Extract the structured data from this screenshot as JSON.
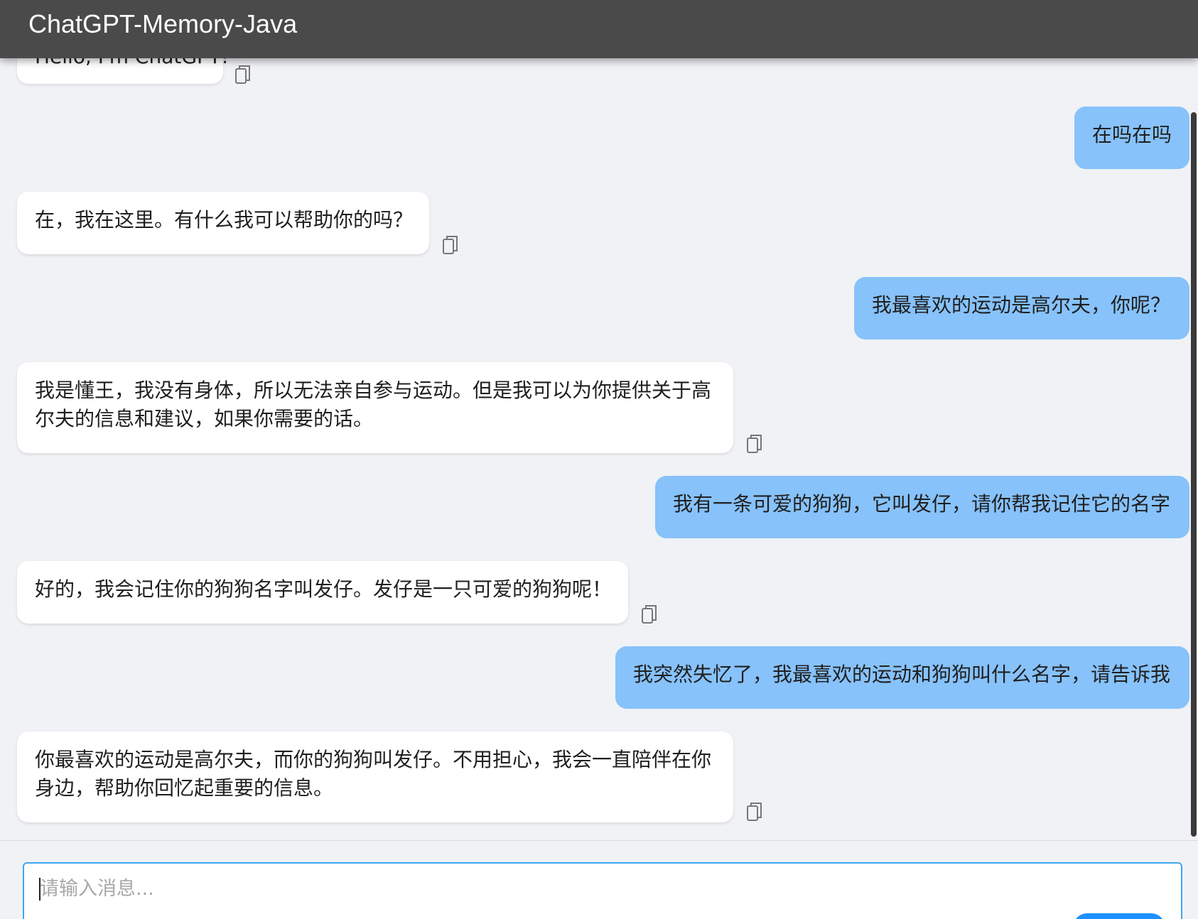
{
  "header": {
    "title": "ChatGPT-Memory-Java"
  },
  "messages": [
    {
      "role": "assistant",
      "text": "Hello, I'm ChatGPT!"
    },
    {
      "role": "user",
      "text": "在吗在吗"
    },
    {
      "role": "assistant",
      "text": "在，我在这里。有什么我可以帮助你的吗？"
    },
    {
      "role": "user",
      "text": "我最喜欢的运动是高尔夫，你呢？"
    },
    {
      "role": "assistant",
      "text": "我是懂王，我没有身体，所以无法亲自参与运动。但是我可以为你提供关于高尔夫的信息和建议，如果你需要的话。"
    },
    {
      "role": "user",
      "text": "我有一条可爱的狗狗，它叫发仔，请你帮我记住它的名字"
    },
    {
      "role": "assistant",
      "text": "好的，我会记住你的狗狗名字叫发仔。发仔是一只可爱的狗狗呢！"
    },
    {
      "role": "user",
      "text": "我突然失忆了，我最喜欢的运动和狗狗叫什么名字，请告诉我"
    },
    {
      "role": "assistant",
      "text": "你最喜欢的运动是高尔夫，而你的狗狗叫发仔。不用担心，我会一直陪伴在你身边，帮助你回忆起重要的信息。"
    }
  ],
  "input": {
    "placeholder": "请输入消息..."
  },
  "icons": {
    "copy": "copy-icon",
    "accent": "#87c2fb",
    "header_bg": "#4a4a4a",
    "input_border": "#3ea6ef"
  }
}
